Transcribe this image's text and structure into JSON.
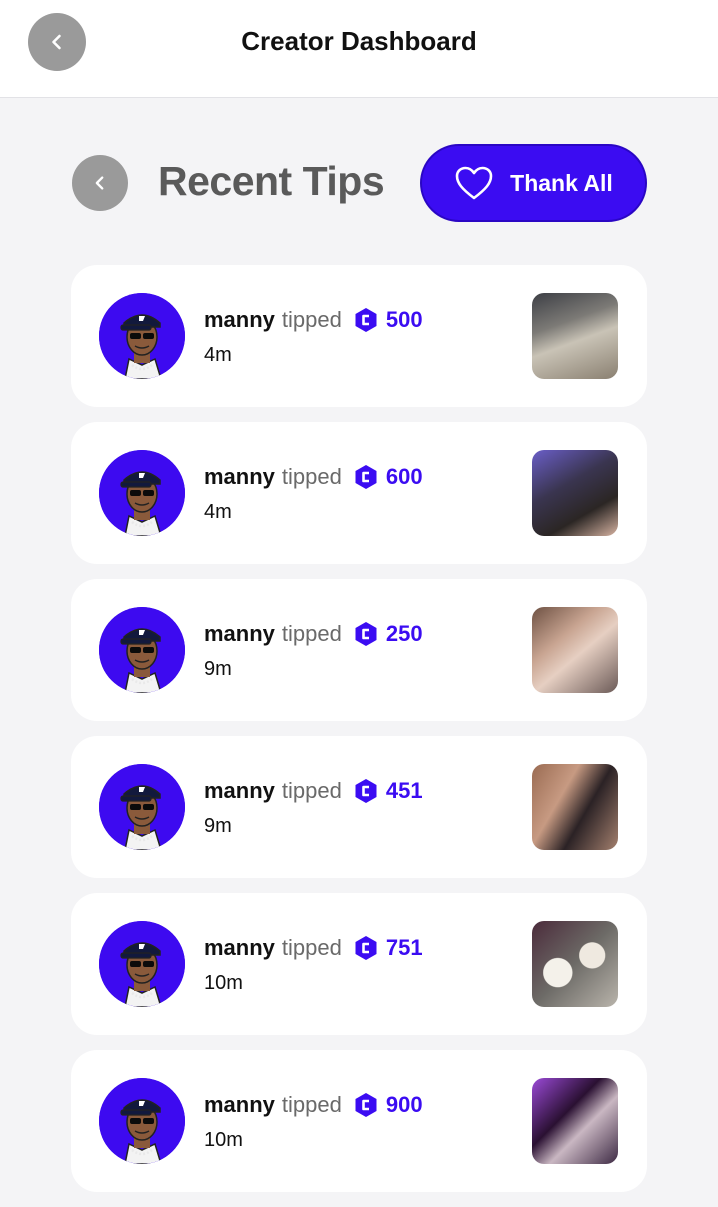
{
  "header": {
    "title": "Creator Dashboard",
    "back_icon": "chevron-left-icon"
  },
  "section": {
    "title": "Recent Tips",
    "back_icon": "chevron-left-icon",
    "thank_all_label": "Thank All",
    "thank_all_icon": "heart-outline-icon"
  },
  "colors": {
    "accent": "#3b0cf2",
    "background": "#f4f4f6",
    "card": "#ffffff"
  },
  "tips": [
    {
      "user": "manny",
      "verb": "tipped",
      "amount": "500",
      "time": "4m"
    },
    {
      "user": "manny",
      "verb": "tipped",
      "amount": "600",
      "time": "4m"
    },
    {
      "user": "manny",
      "verb": "tipped",
      "amount": "250",
      "time": "9m"
    },
    {
      "user": "manny",
      "verb": "tipped",
      "amount": "451",
      "time": "9m"
    },
    {
      "user": "manny",
      "verb": "tipped",
      "amount": "751",
      "time": "10m"
    },
    {
      "user": "manny",
      "verb": "tipped",
      "amount": "900",
      "time": "10m"
    }
  ]
}
